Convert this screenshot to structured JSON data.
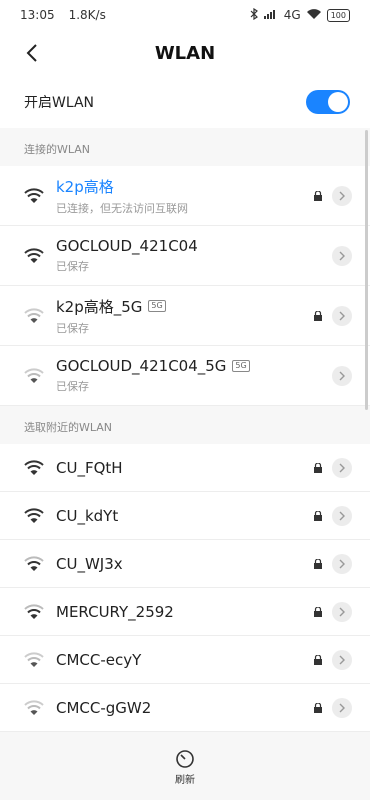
{
  "status": {
    "time": "13:05",
    "speed": "1.8K/s",
    "network": "4G",
    "battery": "100"
  },
  "header": {
    "title": "WLAN"
  },
  "toggle": {
    "label": "开启WLAN",
    "enabled": true
  },
  "connected": {
    "section_label": "连接的WLAN",
    "items": [
      {
        "ssid": "k2p高格",
        "sub": "已连接，但无法访问互联网",
        "band": "",
        "locked": true,
        "signal": "full",
        "active": true
      },
      {
        "ssid": "GOCLOUD_421C04",
        "sub": "已保存",
        "band": "",
        "locked": false,
        "signal": "full",
        "active": false
      },
      {
        "ssid": "k2p高格_5G",
        "sub": "已保存",
        "band": "5G",
        "locked": true,
        "signal": "weak",
        "active": false
      },
      {
        "ssid": "GOCLOUD_421C04_5G",
        "sub": "已保存",
        "band": "5G",
        "locked": false,
        "signal": "weak",
        "active": false
      }
    ]
  },
  "nearby": {
    "section_label": "选取附近的WLAN",
    "items": [
      {
        "ssid": "CU_FQtH",
        "locked": true,
        "signal": "full"
      },
      {
        "ssid": "CU_kdYt",
        "locked": true,
        "signal": "full"
      },
      {
        "ssid": "CU_WJ3x",
        "locked": true,
        "signal": "mid"
      },
      {
        "ssid": "MERCURY_2592",
        "locked": true,
        "signal": "mid"
      },
      {
        "ssid": "CMCC-ecyY",
        "locked": true,
        "signal": "weak"
      },
      {
        "ssid": "CMCC-gGW2",
        "locked": true,
        "signal": "weak"
      }
    ]
  },
  "footer": {
    "refresh_label": "刷新"
  },
  "colors": {
    "accent": "#1a84ff"
  }
}
